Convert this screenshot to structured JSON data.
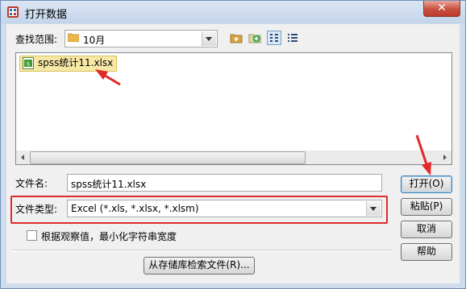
{
  "window": {
    "title": "打开数据",
    "close_icon": "close-icon",
    "app_icon": "spss-app-icon"
  },
  "lookin": {
    "label_text": "查找范围:",
    "label_hotkey": "I",
    "folder": "10月",
    "folder_icon": "folder-icon"
  },
  "toolbar": {
    "icons": [
      "up-folder-icon",
      "new-folder-icon",
      "list-view-icon",
      "details-view-icon"
    ]
  },
  "file_list": {
    "items": [
      {
        "name": "spss统计11.xlsx",
        "icon": "excel-file-icon",
        "selected": true
      }
    ]
  },
  "filename": {
    "label_text": "文件名:",
    "label_hotkey": "N",
    "value": "spss统计11.xlsx"
  },
  "filetype": {
    "label_text": "文件类型:",
    "label_hotkey": "T",
    "value": "Excel (*.xls, *.xlsx, *.xlsm)"
  },
  "minimize_width": {
    "label": "根据观察值，最小化字符串宽度",
    "checked": false
  },
  "buttons": {
    "open": "打开(O)",
    "paste": "粘贴(P)",
    "cancel": "取消",
    "help": "帮助",
    "retrieve": "从存储库检索文件(R)..."
  },
  "colors": {
    "highlight": "#e02a2a",
    "selection": "#f7e8a6",
    "title_bar": "#c3d4ea"
  }
}
